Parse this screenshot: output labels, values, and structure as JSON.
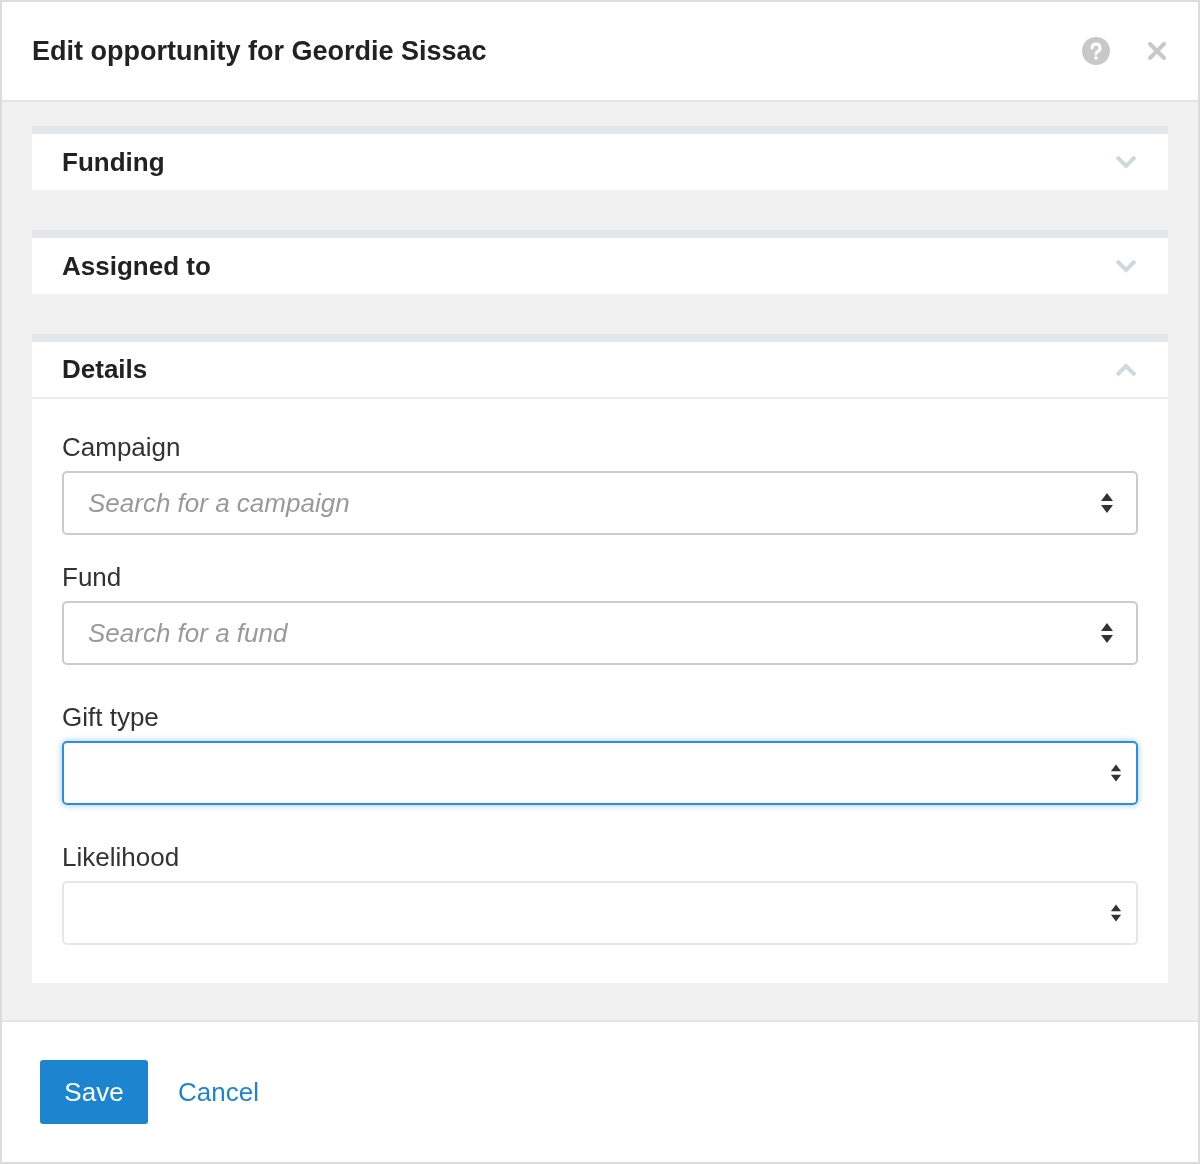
{
  "dialog": {
    "title": "Edit opportunity for Geordie Sissac"
  },
  "sections": [
    {
      "title": "Funding",
      "expanded": false
    },
    {
      "title": "Assigned to",
      "expanded": false
    },
    {
      "title": "Details",
      "expanded": true,
      "fields": [
        {
          "label": "Campaign",
          "kind": "search",
          "placeholder": "Search for a campaign",
          "focused": false
        },
        {
          "label": "Fund",
          "kind": "search",
          "placeholder": "Search for a fund",
          "focused": false
        },
        {
          "label": "Gift type",
          "kind": "select",
          "focused": true
        },
        {
          "label": "Likelihood",
          "kind": "select",
          "focused": false
        }
      ]
    }
  ],
  "buttons": {
    "save": "Save",
    "cancel": "Cancel"
  }
}
